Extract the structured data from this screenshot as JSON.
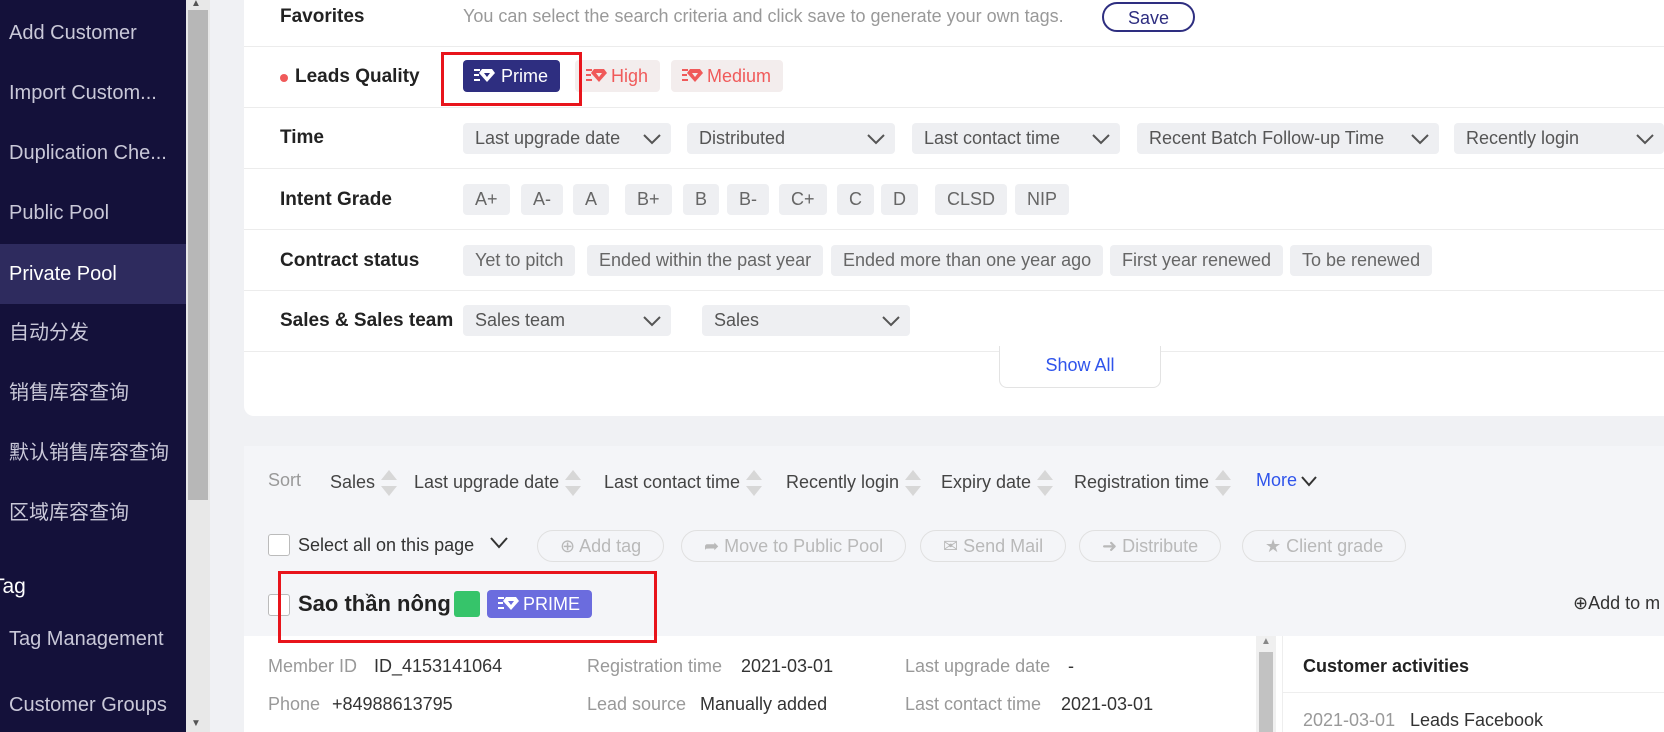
{
  "sidebar": {
    "items": [
      {
        "label": "Add Customer"
      },
      {
        "label": "Import Custom..."
      },
      {
        "label": "Duplication Che..."
      },
      {
        "label": "Public Pool"
      },
      {
        "label": "Private Pool",
        "active": true
      },
      {
        "label": "自动分发"
      },
      {
        "label": "销售库容查询"
      },
      {
        "label": "默认销售库容查询"
      },
      {
        "label": "区域库容查询"
      }
    ],
    "section_label": "Tag",
    "section_items": [
      {
        "label": "Tag Management"
      },
      {
        "label": "Customer Groups"
      }
    ]
  },
  "filters": {
    "favorites": {
      "label": "Favorites",
      "hint": "You can select the search criteria and click save to generate your own tags.",
      "save_label": "Save"
    },
    "leads_quality": {
      "label": "Leads Quality",
      "options": [
        "Prime",
        "High",
        "Medium"
      ],
      "selected": "Prime"
    },
    "time": {
      "label": "Time",
      "dropdowns": [
        "Last upgrade date",
        "Distributed",
        "Last contact time",
        "Recent Batch Follow-up Time",
        "Recently login"
      ]
    },
    "intent_grade": {
      "label": "Intent Grade",
      "options": [
        "A+",
        "A-",
        "A",
        "B+",
        "B",
        "B-",
        "C+",
        "C",
        "D",
        "CLSD",
        "NIP"
      ]
    },
    "contract_status": {
      "label": "Contract status",
      "options": [
        "Yet to pitch",
        "Ended within the past year",
        "Ended more than one year ago",
        "First year renewed",
        "To be renewed"
      ]
    },
    "sales_team": {
      "label": "Sales & Sales team",
      "dropdowns": [
        "Sales team",
        "Sales"
      ]
    },
    "show_all_label": "Show All"
  },
  "sort": {
    "label": "Sort",
    "items": [
      "Sales",
      "Last upgrade date",
      "Last contact time",
      "Recently login",
      "Expiry date",
      "Registration time"
    ],
    "more_label": "More"
  },
  "actions": {
    "select_all_label": "Select all on this page",
    "buttons": [
      "Add tag",
      "Move to Public Pool",
      "Send Mail",
      "Distribute",
      "Client grade"
    ]
  },
  "customer": {
    "name": "Sao thần nông",
    "quality_badge": "PRIME",
    "add_label": "Add to m",
    "fields": {
      "member_id_label": "Member ID",
      "member_id": "ID_4153141064",
      "phone_label": "Phone",
      "phone": "+84988613795",
      "registration_label": "Registration time",
      "registration": "2021-03-01",
      "lead_source_label": "Lead source",
      "lead_source": "Manually added",
      "last_upgrade_label": "Last upgrade date",
      "last_upgrade": "-",
      "last_contact_label": "Last contact time",
      "last_contact": "2021-03-01"
    },
    "activities": {
      "title": "Customer activities",
      "first_date": "2021-03-01",
      "first_text": "Leads",
      "first_source": "Facebook"
    }
  },
  "colors": {
    "sidebar_bg": "#14113a",
    "active_nav": "#2e2b5e",
    "prime_chip": "#2e2e80",
    "quality_light_text": "#f05a5a",
    "highlight_border": "#e8141b",
    "link_blue": "#2f54eb"
  }
}
